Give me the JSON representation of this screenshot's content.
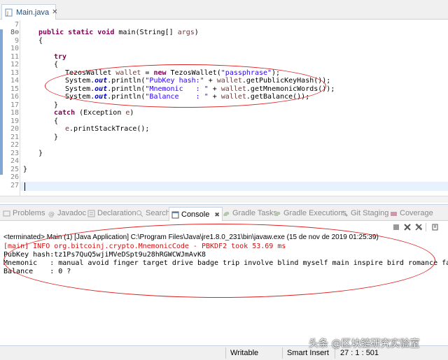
{
  "editor": {
    "tab_label": "Main.java",
    "lines": [
      {
        "n": "7"
      },
      {
        "n": "8⊖"
      },
      {
        "n": "9"
      },
      {
        "n": "10"
      },
      {
        "n": "11"
      },
      {
        "n": "12"
      },
      {
        "n": "13"
      },
      {
        "n": "14"
      },
      {
        "n": "15"
      },
      {
        "n": "16"
      },
      {
        "n": "17"
      },
      {
        "n": "18"
      },
      {
        "n": "19"
      },
      {
        "n": "20"
      },
      {
        "n": "21"
      },
      {
        "n": "22"
      },
      {
        "n": "23"
      },
      {
        "n": "24"
      },
      {
        "n": "25"
      },
      {
        "n": "26"
      },
      {
        "n": "27"
      }
    ],
    "code": {
      "l8_a": "public static void ",
      "l8_b": "main(String[] ",
      "l8_c": "args",
      "l8_d": ")",
      "l9": "{",
      "l11": "try",
      "l12": "{",
      "l13_a": "TezosWallet ",
      "l13_b": "wallet",
      "l13_c": " = ",
      "l13_d": "new",
      "l13_e": " TezosWallet(",
      "l13_f": "\"passphrase\"",
      "l13_g": ");",
      "l14_a": "System.",
      "l14_b": "out",
      "l14_c": ".println(",
      "l14_d": "\"PubKey hash:\"",
      "l14_e": " + ",
      "l14_f": "wallet",
      "l14_g": ".getPublicKeyHash());",
      "l15_a": "System.",
      "l15_b": "out",
      "l15_c": ".println(",
      "l15_d": "\"Mnemonic   : \"",
      "l15_e": " + ",
      "l15_f": "wallet",
      "l15_g": ".getMnemonicWords());",
      "l16_a": "System.",
      "l16_b": "out",
      "l16_c": ".println(",
      "l16_d": "\"Balance    : \"",
      "l16_e": " + ",
      "l16_f": "wallet",
      "l16_g": ".getBalance());",
      "l17": "}",
      "l18_a": "catch",
      "l18_b": " (Exception ",
      "l18_c": "e",
      "l18_d": ")",
      "l19": "{",
      "l20_a": "e",
      "l20_b": ".printStackTrace();",
      "l21": "}",
      "l23": "}",
      "l25": "}"
    }
  },
  "views": {
    "tabs": [
      {
        "label": "Problems",
        "icon": "problems-icon"
      },
      {
        "label": "Javadoc",
        "icon": "javadoc-icon"
      },
      {
        "label": "Declaration",
        "icon": "declaration-icon"
      },
      {
        "label": "Search",
        "icon": "search-icon"
      },
      {
        "label": "Console",
        "icon": "console-icon",
        "close": "✖"
      },
      {
        "label": "Gradle Tasks",
        "icon": "gradle-icon"
      },
      {
        "label": "Gradle Executions",
        "icon": "gradle-icon"
      },
      {
        "label": "Git Staging",
        "icon": "git-icon"
      },
      {
        "label": "Coverage",
        "icon": "coverage-icon"
      }
    ]
  },
  "console": {
    "terminated": "<terminated> Main (1) [Java Application] C:\\Program Files\\Java\\jre1.8.0_231\\bin\\javaw.exe (15 de nov de 2019 01:25:39)",
    "output": [
      "[main] INFO org.bitcoinj.crypto.MnemonicCode - PBKDF2 took 53.69 ms",
      "PubKey hash:tz1Ps7QuQ5wjiMVeDSpt9u28hRGWCWJmAvK8",
      "Mnemonic   : manual avoid finger target drive badge trip involve blind myself main inspire bird romance face",
      "Balance    : 0 ?"
    ]
  },
  "statusbar": {
    "writable": "Writable",
    "insert_mode": "Smart Insert",
    "position": "27 : 1 : 501"
  },
  "watermark": "头条 @区块链研究实验室",
  "colors": {
    "keyword": "#7f0055",
    "string": "#2a00ff",
    "field": "#0000c0",
    "error": "#d01010",
    "annotation": "#d22222"
  }
}
